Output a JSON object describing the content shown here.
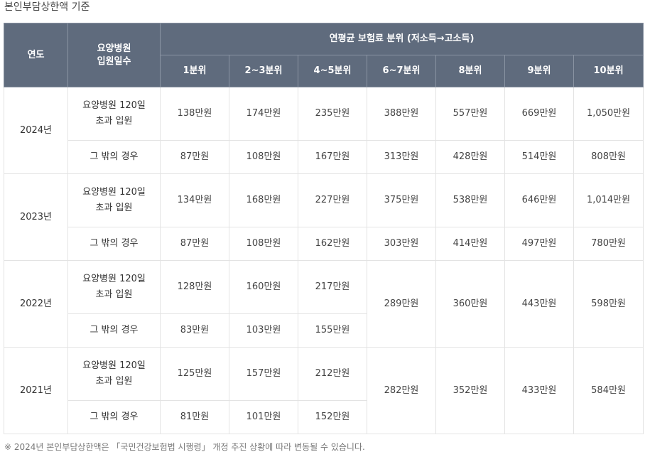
{
  "title": "본인부담상한액 기준",
  "header": {
    "year": "연도",
    "days": "요양병원\n입원일수",
    "group": "연평균 보험료 분위 (저소득→고소득)",
    "deciles": [
      "1분위",
      "2~3분위",
      "4~5분위",
      "6~7분위",
      "8분위",
      "9분위",
      "10분위"
    ]
  },
  "rows": [
    {
      "year": "2024년",
      "a_label": "요양병원 120일\n초과 입원",
      "a_values": [
        "138만원",
        "174만원",
        "235만원",
        "388만원",
        "557만원",
        "669만원",
        "1,050만원"
      ],
      "b_label": "그 밖의 경우",
      "b_values": [
        "87만원",
        "108만원",
        "167만원",
        "313만원",
        "428만원",
        "514만원",
        "808만원"
      ]
    },
    {
      "year": "2023년",
      "a_label": "요양병원 120일\n초과 입원",
      "a_values": [
        "134만원",
        "168만원",
        "227만원",
        "375만원",
        "538만원",
        "646만원",
        "1,014만원"
      ],
      "b_label": "그 밖의 경우",
      "b_values": [
        "87만원",
        "108만원",
        "162만원",
        "303만원",
        "414만원",
        "497만원",
        "780만원"
      ]
    },
    {
      "year": "2022년",
      "a_label": "요양병원 120일\n초과 입원",
      "a_values": [
        "128만원",
        "160만원",
        "217만원"
      ],
      "b_label": "그 밖의 경우",
      "b_values": [
        "83만원",
        "103만원",
        "155만원"
      ],
      "shared": [
        "289만원",
        "360만원",
        "443만원",
        "598만원"
      ]
    },
    {
      "year": "2021년",
      "a_label": "요양병원 120일\n초과 입원",
      "a_values": [
        "125만원",
        "157만원",
        "212만원"
      ],
      "b_label": "그 밖의 경우",
      "b_values": [
        "81만원",
        "101만원",
        "152만원"
      ],
      "shared": [
        "282만원",
        "352만원",
        "433만원",
        "584만원"
      ]
    }
  ],
  "footnote": "※ 2024년 본인부담상한액은 「국민건강보험법 시행령」 개정 추진 상황에 따라 변동될 수 있습니다."
}
